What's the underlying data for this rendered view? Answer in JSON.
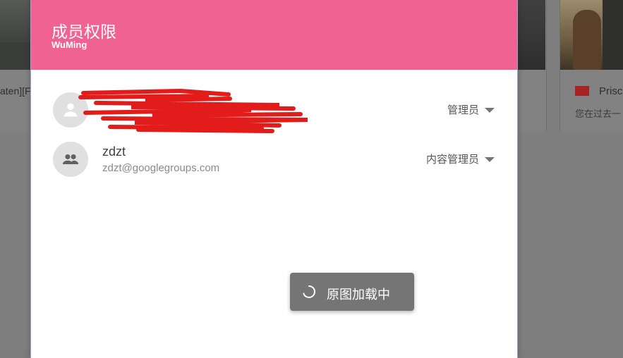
{
  "background": {
    "left_card": {
      "text": "aten][F"
    },
    "right_card": {
      "title": "Prisc",
      "subtitle": "您在过去一"
    }
  },
  "dialog": {
    "title": "成员权限",
    "subtitle": "WuMing",
    "members": [
      {
        "name": "",
        "email": "",
        "role": "管理员",
        "avatar_icon": "person-icon",
        "redacted": true
      },
      {
        "name": "zdzt",
        "email": "zdzt@googlegroups.com",
        "role": "内容管理员",
        "avatar_icon": "group-icon"
      }
    ]
  },
  "toast": {
    "text": "原图加载中"
  },
  "colors": {
    "header": "#f06292",
    "redaction": "#e21b1b"
  }
}
